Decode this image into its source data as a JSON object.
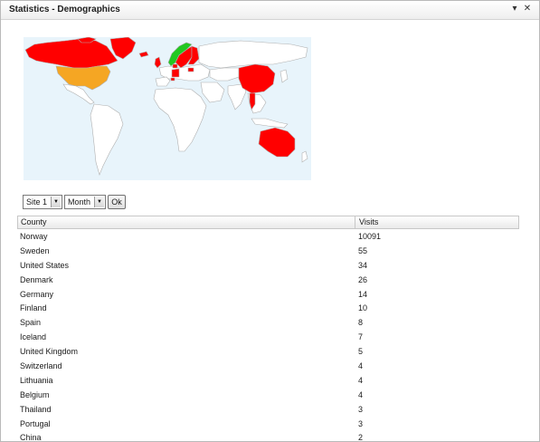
{
  "window": {
    "title": "Statistics - Demographics",
    "controls": {
      "menu_icon": "chevron-down-icon",
      "close_icon": "close-icon",
      "menu_glyph": "▾",
      "close_glyph": "✕"
    }
  },
  "map": {
    "colors": {
      "ocean": "#e8f4fb",
      "land": "#ffffff",
      "border": "#b0b0b0",
      "top": "#21c821",
      "high": "#f5a623",
      "medium": "#ff0000"
    },
    "highlighted": {
      "Norway": "top",
      "United States": "high",
      "Canada": "medium",
      "Sweden": "medium",
      "Greenland": "medium",
      "Iceland": "medium",
      "China": "medium",
      "Australia": "medium",
      "Thailand": "medium",
      "Spain": "medium",
      "Portugal": "medium"
    }
  },
  "filters": {
    "site": "Site 1",
    "period": "Month",
    "ok_label": "Ok",
    "arrow_glyph": "▼"
  },
  "table": {
    "headers": [
      "County",
      "Visits"
    ],
    "rows": [
      {
        "country": "Norway",
        "visits": "10091"
      },
      {
        "country": "Sweden",
        "visits": "55"
      },
      {
        "country": "United States",
        "visits": "34"
      },
      {
        "country": "Denmark",
        "visits": "26"
      },
      {
        "country": "Germany",
        "visits": "14"
      },
      {
        "country": "Finland",
        "visits": "10"
      },
      {
        "country": "Spain",
        "visits": "8"
      },
      {
        "country": "Iceland",
        "visits": "7"
      },
      {
        "country": "United Kingdom",
        "visits": "5"
      },
      {
        "country": "Switzerland",
        "visits": "4"
      },
      {
        "country": "Lithuania",
        "visits": "4"
      },
      {
        "country": "Belgium",
        "visits": "4"
      },
      {
        "country": "Thailand",
        "visits": "3"
      },
      {
        "country": "Portugal",
        "visits": "3"
      },
      {
        "country": "China",
        "visits": "2"
      }
    ]
  }
}
